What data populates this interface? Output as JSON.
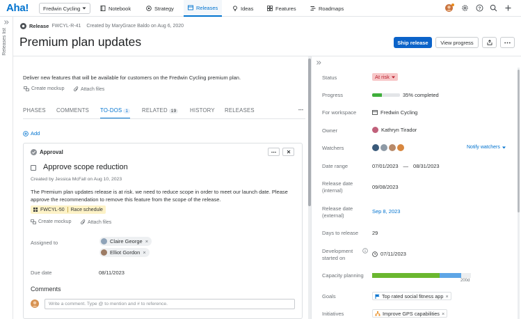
{
  "app": {
    "logo": "Aha!"
  },
  "workspace_select": {
    "value": "Fredwin Cycling"
  },
  "nav": {
    "tabs": [
      {
        "label": "Notebook",
        "icon": "notebook-icon"
      },
      {
        "label": "Strategy",
        "icon": "strategy-icon"
      },
      {
        "label": "Releases",
        "icon": "releases-icon",
        "active": true
      },
      {
        "label": "Ideas",
        "icon": "lightbulb-icon"
      },
      {
        "label": "Features",
        "icon": "features-icon"
      },
      {
        "label": "Roadmaps",
        "icon": "roadmaps-icon"
      }
    ]
  },
  "sidebar": {
    "label": "Releases list"
  },
  "release": {
    "type_label": "Release",
    "key": "FWCYL-R-41",
    "created": "Created by MaryGrace Baldo on Aug 6, 2020",
    "title": "Premium plan updates",
    "description": "Deliver new features that will be available for customers on the Fredwin Cycling premium plan.",
    "create_mockup": "Create mockup",
    "attach_files": "Attach files"
  },
  "header_actions": {
    "ship": "Ship release",
    "view_progress": "View progress"
  },
  "subtabs": [
    {
      "label": "PHASES"
    },
    {
      "label": "COMMENTS"
    },
    {
      "label": "TO-DOS",
      "count": "1",
      "active": true
    },
    {
      "label": "RELATED",
      "count": "19"
    },
    {
      "label": "HISTORY"
    },
    {
      "label": "RELEASES"
    }
  ],
  "todos": {
    "add_label": "Add",
    "card": {
      "type": "Approval",
      "title": "Approve scope reduction",
      "created": "Created by Jessica McFall on Aug 10, 2023",
      "description": "The Premium plan updates release is at risk. we need to reduce scope in order to meet our launch date. Please approve the recommendation to remove this feature from the scope of the release.",
      "feature_key": "FWCYL-50",
      "feature_name": "Race schedule",
      "create_mockup": "Create mockup",
      "attach_files": "Attach files",
      "assigned_label": "Assigned to",
      "assignees": [
        "Claire George",
        "Elliot Gordon"
      ],
      "due_label": "Due date",
      "due_value": "08/11/2023",
      "comments_heading": "Comments",
      "comment_placeholder": "Write a comment. Type @ to mention and # to reference."
    }
  },
  "details": {
    "status": {
      "label": "Status",
      "value": "At risk",
      "color": "#f7c7c8"
    },
    "progress": {
      "label": "Progress",
      "value": "35% completed",
      "percent": 35
    },
    "workspace": {
      "label": "For workspace",
      "value": "Fredwin Cycling"
    },
    "owner": {
      "label": "Owner",
      "value": "Kathryn Tirador"
    },
    "watchers": {
      "label": "Watchers",
      "notify": "Notify watchers"
    },
    "date_range": {
      "label": "Date range",
      "start": "07/01/2023",
      "sep": "—",
      "end": "08/31/2023"
    },
    "release_internal": {
      "label": "Release date (internal)",
      "value": "09/08/2023"
    },
    "release_external": {
      "label": "Release date (external)",
      "value": "Sep 8, 2023"
    },
    "days_to_release": {
      "label": "Days to release",
      "value": "29"
    },
    "dev_started": {
      "label": "Development started on",
      "value": "07/11/2023"
    },
    "capacity": {
      "label": "Capacity planning",
      "caption": "200d",
      "green_fraction": 0.68,
      "blue_fraction": 0.22
    },
    "goals": {
      "label": "Goals",
      "value": "Top rated social fitness app"
    },
    "initiatives": {
      "label": "Initiatives",
      "value": "Improve GPS capabilities"
    }
  },
  "colors": {
    "brand": "#0073cf",
    "ship_button": "#0b63c9",
    "progress_green": "#3fae3b",
    "capacity_green": "#6ab72f",
    "capacity_blue": "#5ea6e6",
    "at_risk_text": "#b81e2c"
  }
}
